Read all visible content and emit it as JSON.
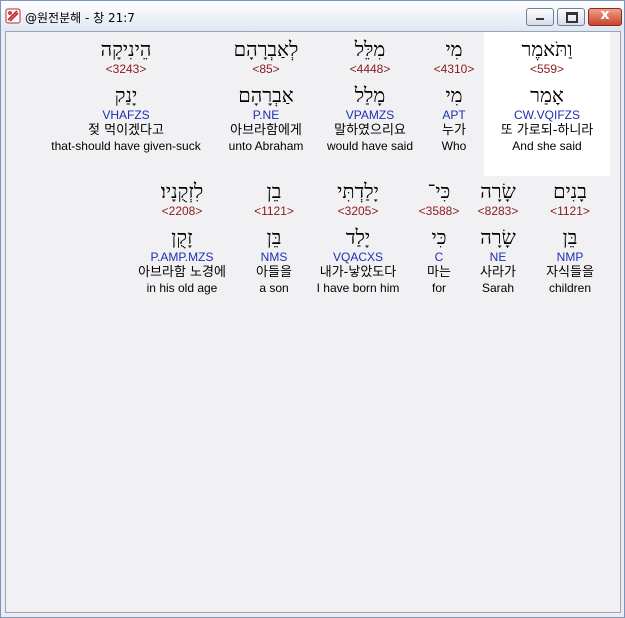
{
  "window": {
    "title": "@원전분해 - 창 21:7",
    "min_icon": "minimize-icon",
    "max_icon": "maximize-icon",
    "close_icon": "close-icon",
    "close_glyph": "x"
  },
  "rows": [
    {
      "words": [
        {
          "word": "הֵינִיקָה",
          "strong": "<3243>",
          "lemma": "יָנַק",
          "morph": "VHAFZS",
          "korean": "젖 먹이겠다고",
          "english": "that-should have given-suck",
          "selected": false
        },
        {
          "word": "לְאַבְרָהָם",
          "strong": "<85>",
          "lemma": "אַבְרָהָם",
          "morph": "P.NE",
          "korean": "아브라함에게",
          "english": "unto Abraham",
          "selected": false
        },
        {
          "word": "מִלֵּל",
          "strong": "<4448>",
          "lemma": "מָלַל",
          "morph": "VPAMZS",
          "korean": "말하였으리요",
          "english": "would have said",
          "selected": false
        },
        {
          "word": "מִי",
          "strong": "<4310>",
          "lemma": "מִי",
          "morph": "APT",
          "korean": "누가",
          "english": "Who",
          "selected": false
        },
        {
          "word": "וַתֹּאמֶר",
          "strong": "<559>",
          "lemma": "אָמַר",
          "morph": "CW.VQIFZS",
          "korean": "또 가로되-하니라",
          "english": "And she said",
          "selected": true
        }
      ]
    },
    {
      "words": [
        {
          "word": "לִזְקֻנָיו׃",
          "strong": "<2208>",
          "lemma": "זָקֻן",
          "morph": "P.AMP.MZS",
          "korean": "아브라함 노경에",
          "english": "in his old age",
          "selected": false
        },
        {
          "word": "בֵן",
          "strong": "<1121>",
          "lemma": "בֵּן",
          "morph": "NMS",
          "korean": "아들을",
          "english": "a son",
          "selected": false
        },
        {
          "word": "יָלַדְתִּי",
          "strong": "<3205>",
          "lemma": "יָלַד",
          "morph": "VQACXS",
          "korean": "내가-낳았도다",
          "english": "I have born him",
          "selected": false
        },
        {
          "word": "כִּי־",
          "strong": "<3588>",
          "lemma": "כִּי",
          "morph": "C",
          "korean": "마는",
          "english": "for",
          "selected": false
        },
        {
          "word": "שָׂרָה",
          "strong": "<8283>",
          "lemma": "שָׂרָה",
          "morph": "NE",
          "korean": "사라가",
          "english": "Sarah",
          "selected": false
        },
        {
          "word": "בָנִים",
          "strong": "<1121>",
          "lemma": "בֵּן",
          "morph": "NMP",
          "korean": "자식들을",
          "english": "children",
          "selected": false
        }
      ]
    }
  ]
}
